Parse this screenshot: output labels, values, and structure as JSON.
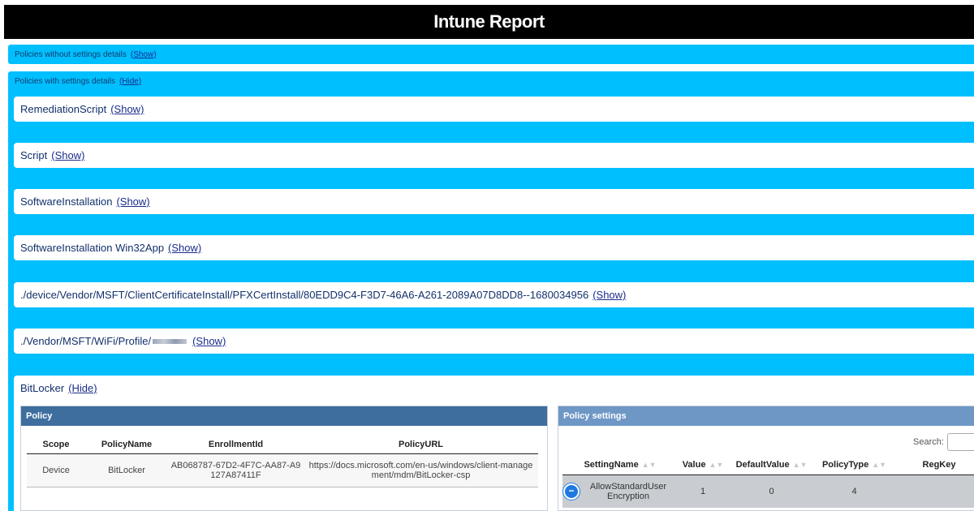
{
  "header": {
    "title": "Intune Report"
  },
  "sections": {
    "without": {
      "label": "Policies without settings details",
      "toggle": "(Show)"
    },
    "with": {
      "label": "Policies with settings details",
      "toggle": "(Hide)"
    }
  },
  "rows": [
    {
      "label": "RemediationScript",
      "toggle": "(Show)"
    },
    {
      "label": "Script",
      "toggle": "(Show)"
    },
    {
      "label": "SoftwareInstallation",
      "toggle": "(Show)"
    },
    {
      "label": "SoftwareInstallation Win32App",
      "toggle": "(Show)"
    },
    {
      "label": "./device/Vendor/MSFT/ClientCertificateInstall/PFXCertInstall/80EDD9C4-F3D7-46A6-A261-2089A07D8DD8--1680034956",
      "toggle": "(Show)"
    },
    {
      "label_prefix": "./Vendor/MSFT/WiFi/Profile/",
      "toggle": "(Show)"
    }
  ],
  "bitlocker": {
    "label": "BitLocker",
    "toggle": "(Hide)",
    "policy_header": "Policy",
    "policy_columns": [
      "Scope",
      "PolicyName",
      "EnrollmentId",
      "PolicyURL"
    ],
    "policy_row": {
      "scope": "Device",
      "name": "BitLocker",
      "enrollment_line1": "AB068787-67D2-4F7C-AA87-A9",
      "enrollment_line2": "127A87411F",
      "url_line1": "https://docs.microsoft.com/en-us/windows/client-manage",
      "url_line2": "ment/mdm/BitLocker-csp"
    },
    "settings_header": "Policy settings",
    "search_label": "Search:",
    "settings_columns": [
      "SettingName",
      "Value",
      "DefaultValue",
      "PolicyType",
      "RegKey"
    ],
    "settings_row": {
      "name_line1": "AllowStandardUser",
      "name_line2": "Encryption",
      "value": "1",
      "default": "0",
      "type": "4"
    }
  },
  "icons": {
    "expand": "minus-circle-icon"
  }
}
